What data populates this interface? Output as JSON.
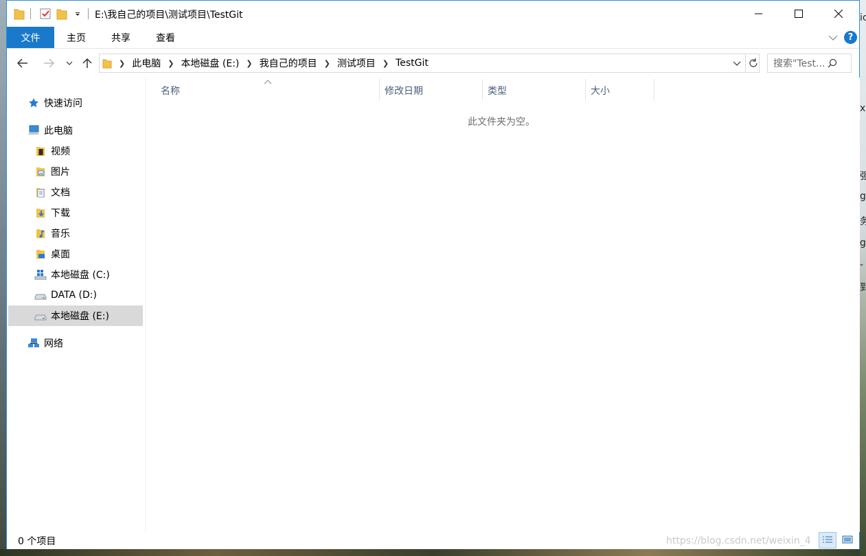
{
  "window": {
    "title": "E:\\我自己的项目\\测试项目\\TestGit"
  },
  "ribbon": {
    "tabs": [
      {
        "label": "文件",
        "active": true
      },
      {
        "label": "主页"
      },
      {
        "label": "共享"
      },
      {
        "label": "查看"
      }
    ],
    "help_label": "?"
  },
  "address": {
    "crumbs": [
      "此电脑",
      "本地磁盘 (E:)",
      "我自己的项目",
      "测试项目",
      "TestGit"
    ]
  },
  "search": {
    "placeholder": "搜索\"Test..."
  },
  "sidebar": {
    "items": [
      {
        "label": "快速访问",
        "icon": "star-icon"
      },
      {
        "label": "此电脑",
        "icon": "computer-icon"
      },
      {
        "label": "视频",
        "icon": "videos-folder-icon"
      },
      {
        "label": "图片",
        "icon": "pictures-folder-icon"
      },
      {
        "label": "文档",
        "icon": "documents-folder-icon"
      },
      {
        "label": "下载",
        "icon": "downloads-folder-icon"
      },
      {
        "label": "音乐",
        "icon": "music-folder-icon"
      },
      {
        "label": "桌面",
        "icon": "desktop-folder-icon"
      },
      {
        "label": "本地磁盘 (C:)",
        "icon": "windows-drive-icon"
      },
      {
        "label": "DATA (D:)",
        "icon": "drive-icon"
      },
      {
        "label": "本地磁盘 (E:)",
        "icon": "drive-icon",
        "selected": true
      },
      {
        "label": "网络",
        "icon": "network-icon"
      }
    ]
  },
  "columns": [
    "名称",
    "修改日期",
    "类型",
    "大小"
  ],
  "content": {
    "empty_message": "此文件夹为空。"
  },
  "status": {
    "item_count": "0 个项目"
  },
  "watermark": "https://blog.csdn.net/weixin_4",
  "desktop_fragments": [
    "ic",
    "x",
    "强",
    "g",
    "务",
    "g",
    "-",
    "到"
  ],
  "colors": {
    "accent": "#1979ca",
    "selected_bg": "#d9d9d9",
    "column_header": "#4c607a"
  }
}
